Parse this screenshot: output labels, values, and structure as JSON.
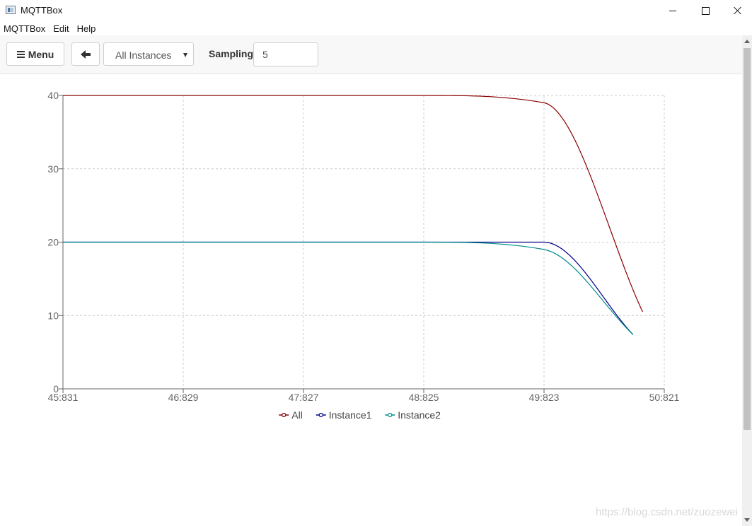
{
  "window": {
    "title": "MQTTBox",
    "controls": {
      "minimize": "minimize",
      "maximize": "maximize",
      "close": "close"
    }
  },
  "menubar": {
    "items": [
      "MQTTBox",
      "Edit",
      "Help"
    ]
  },
  "toolbar": {
    "menu_label": "Menu",
    "back_icon": "arrow-left-icon",
    "instance_select": {
      "value": "All Instances"
    },
    "sampling_label": "Sampling",
    "sampling_value": "5"
  },
  "chart_data": {
    "type": "line",
    "title": "",
    "xlabel": "",
    "ylabel": "",
    "x_ticks": [
      "45:831",
      "46:829",
      "47:827",
      "48:825",
      "49:823",
      "50:821"
    ],
    "y_ticks": [
      0,
      10,
      20,
      30,
      40
    ],
    "ylim": [
      0,
      40
    ],
    "grid": true,
    "legend_position": "bottom",
    "series": [
      {
        "name": "All",
        "color": "#8b0000",
        "points": [
          [
            0,
            40
          ],
          [
            1,
            40
          ],
          [
            2,
            40
          ],
          [
            3,
            40
          ],
          [
            4,
            39
          ],
          [
            4.82,
            10.5
          ]
        ]
      },
      {
        "name": "Instance1",
        "color": "#00008b",
        "points": [
          [
            0,
            20
          ],
          [
            1,
            20
          ],
          [
            2,
            20
          ],
          [
            3,
            20
          ],
          [
            4,
            20
          ],
          [
            4.74,
            7.4
          ]
        ]
      },
      {
        "name": "Instance2",
        "color": "#008b8b",
        "points": [
          [
            0,
            20
          ],
          [
            1,
            20
          ],
          [
            2,
            20
          ],
          [
            3,
            20
          ],
          [
            4,
            19
          ],
          [
            4.74,
            7.4
          ]
        ]
      }
    ]
  },
  "watermark": "https://blog.csdn.net/zuozewei"
}
